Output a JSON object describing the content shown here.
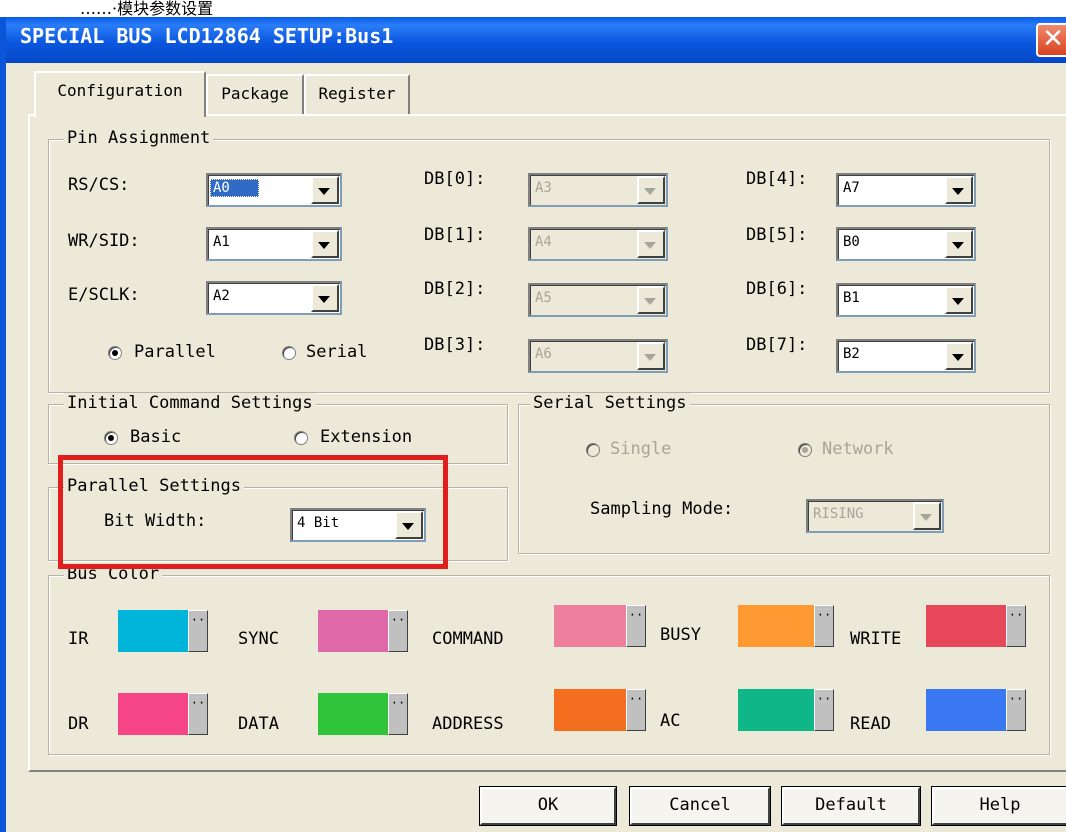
{
  "caption_strip": {
    "text": "……·模块参数设置"
  },
  "window": {
    "title": "SPECIAL BUS LCD12864 SETUP:Bus1",
    "close_symbol": "✕"
  },
  "tabs": [
    {
      "label": "Configuration"
    },
    {
      "label": "Package"
    },
    {
      "label": "Register"
    }
  ],
  "pin_assignment": {
    "legend": "Pin Assignment",
    "rows": [
      {
        "label": "RS/CS:",
        "value": "A0"
      },
      {
        "label": "WR/SID:",
        "value": "A1"
      },
      {
        "label": "E/SCLK:",
        "value": "A2"
      }
    ],
    "db_low": [
      {
        "label": "DB[0]:",
        "value": "A3"
      },
      {
        "label": "DB[1]:",
        "value": "A4"
      },
      {
        "label": "DB[2]:",
        "value": "A5"
      },
      {
        "label": "DB[3]:",
        "value": "A6"
      }
    ],
    "db_high": [
      {
        "label": "DB[4]:",
        "value": "A7"
      },
      {
        "label": "DB[5]:",
        "value": "B0"
      },
      {
        "label": "DB[6]:",
        "value": "B1"
      },
      {
        "label": "DB[7]:",
        "value": "B2"
      }
    ],
    "mode_parallel": "Parallel",
    "mode_serial": "Serial",
    "selected_mode": "Parallel"
  },
  "initial_command": {
    "legend": "Initial Command Settings",
    "basic": "Basic",
    "extension": "Extension",
    "selected": "Basic"
  },
  "parallel_settings": {
    "legend": "Parallel Settings",
    "bit_width_label": "Bit Width:",
    "bit_width_value": "4 Bit"
  },
  "serial_settings": {
    "legend": "Serial Settings",
    "single": "Single",
    "network": "Network",
    "selected": "Network",
    "sampling_label": "Sampling Mode:",
    "sampling_value": "RISING"
  },
  "bus_color": {
    "legend": "Bus Color",
    "row1": [
      {
        "label": "IR",
        "color": "#00b4da"
      },
      {
        "label": "SYNC",
        "color": "#de68a8"
      },
      {
        "label": "COMMAND",
        "color": "#ef7f9f"
      },
      {
        "label": "BUSY",
        "color": "#ff9a33"
      },
      {
        "label": "WRITE",
        "color": "#e6485a"
      }
    ],
    "row2": [
      {
        "label": "DR",
        "color": "#f64587"
      },
      {
        "label": "DATA",
        "color": "#2fc43a"
      },
      {
        "label": "ADDRESS",
        "color": "#f46e20"
      },
      {
        "label": "AC",
        "color": "#0fb788"
      },
      {
        "label": "READ",
        "color": "#3a78f2"
      }
    ],
    "swatch_button_symbol": "··"
  },
  "buttons": {
    "ok": "OK",
    "cancel": "Cancel",
    "default": "Default",
    "help": "Help"
  },
  "colors": {
    "titlebar": "#0b57df",
    "dialog_bg": "#ece9d8",
    "highlight": "#e21d1d"
  }
}
